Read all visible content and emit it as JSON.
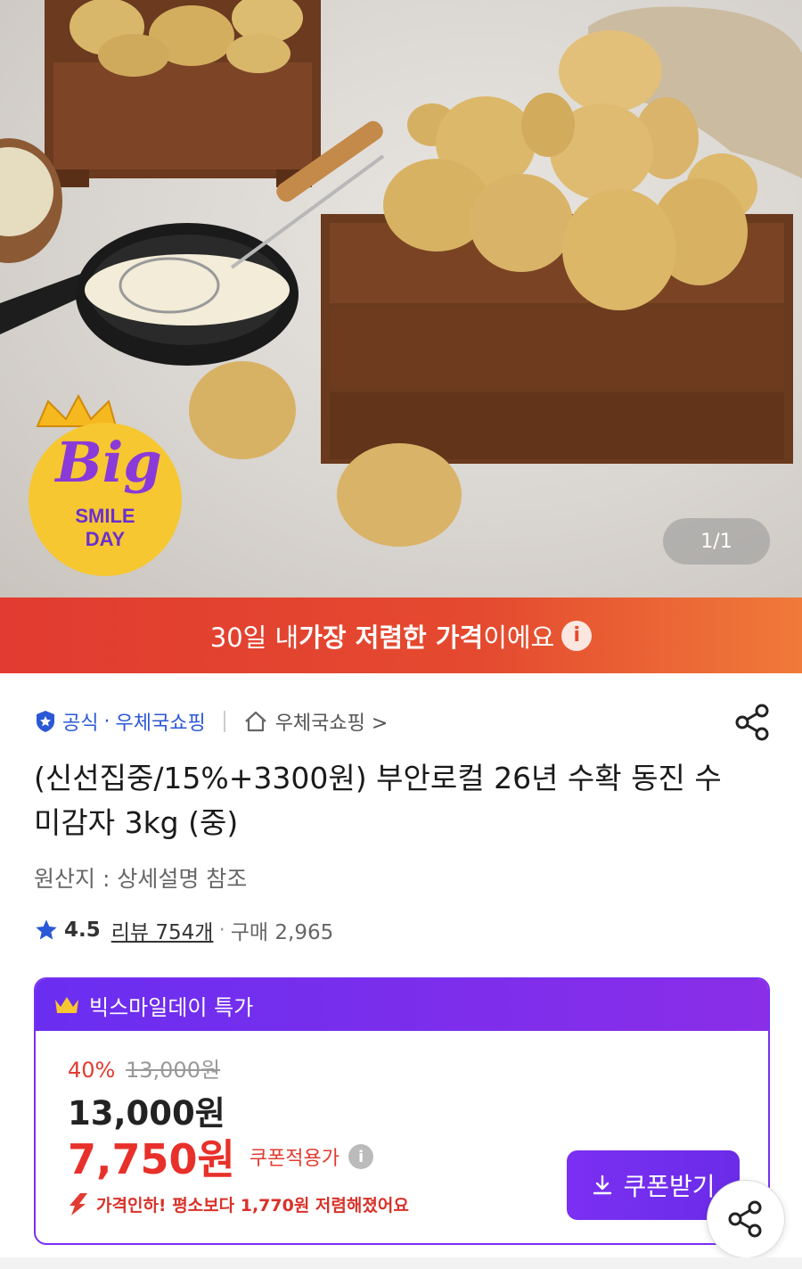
{
  "hero": {
    "image_icon": "potato-product-photo",
    "badge": {
      "line1": "Big",
      "line2": "SMILE",
      "line3": "DAY"
    },
    "counter": "1/1"
  },
  "banner": {
    "prefix": "30일 내 ",
    "highlight": "가장 저렴한 가격",
    "suffix": "이에요",
    "info_icon": "i"
  },
  "seller": {
    "official_label": "공식",
    "dot": "·",
    "official_store": "우체국쇼핑",
    "store_link": "우체국쇼핑 >"
  },
  "product": {
    "title": "(신선집중/15%+3300원) 부안로컬 26년 수확 동진 수미감자 3kg (중)",
    "origin": "원산지 : 상세설명 참조",
    "rating": "4.5",
    "reviews": "리뷰 754개",
    "dot": "·",
    "purchases": "구매 2,965"
  },
  "deal": {
    "header": "빅스마일데이 특가",
    "discount_rate": "40%",
    "original_price": "13,000원",
    "price": "13,000원",
    "coupon_price": "7,750원",
    "coupon_label": "쿠폰적용가",
    "help_icon": "i",
    "price_drop": "가격인하! 평소보다 1,770원 저렴해졌어요",
    "coupon_button": "쿠폰받기"
  },
  "colors": {
    "banner": "#e44a2f",
    "deal_purple": "#7b2ff2",
    "price_red": "#e8302a",
    "official_blue": "#2b58d6"
  }
}
